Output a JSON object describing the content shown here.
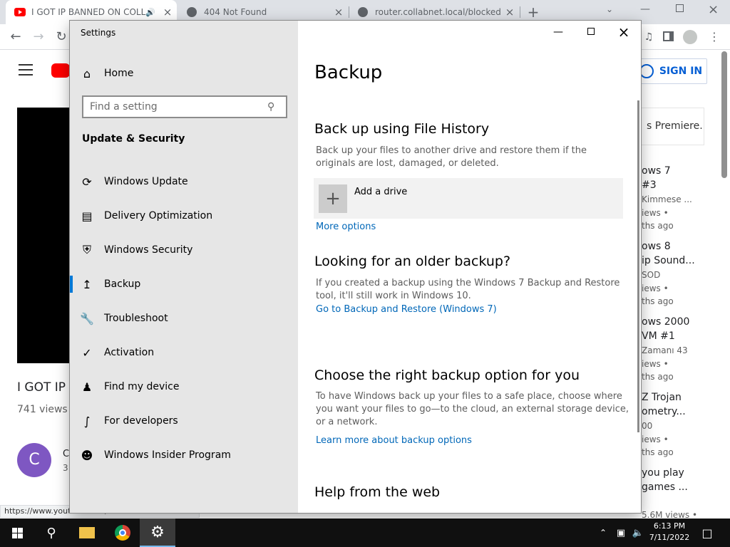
{
  "browser": {
    "tabs": [
      {
        "title": "I GOT IP BANNED ON COLLA",
        "icon": "youtube-icon"
      },
      {
        "title": "404 Not Found",
        "icon": "globe-icon"
      },
      {
        "title": "router.collabnet.local/blocked.ph",
        "icon": "globe-icon"
      }
    ],
    "status_url": "https://www.youtube.com/watch?v=..."
  },
  "youtube": {
    "sign_in": "SIGN IN",
    "premiere_text": "s Premiere.",
    "video_title": "I GOT IP B",
    "views": "741 views •",
    "avatar_letter": "C",
    "channel_initial": "C",
    "sub_count": "3",
    "recs": [
      {
        "l1": "ows 7",
        "l2": "#3",
        "l3": "Kimmese ...",
        "l4": "iews •",
        "l5": "ths ago"
      },
      {
        "l1": "ows 8",
        "l2": "ip Sound...",
        "l3": "SOD",
        "l4": "iews •",
        "l5": "ths ago"
      },
      {
        "l1": "ows 2000",
        "l2": "VM #1",
        "l3": "Zamanı 43",
        "l4": "iews •",
        "l5": "ths ago"
      },
      {
        "l1": "Z Trojan",
        "l2": "ometry...",
        "l3": "00",
        "l4": "iews •",
        "l5": "ths ago"
      },
      {
        "l1": "you play",
        "l2": "games ...",
        "l3": "",
        "l4": "5.6M views •",
        "l5": ""
      }
    ]
  },
  "settings": {
    "window_title": "Settings",
    "home": "Home",
    "search_placeholder": "Find a setting",
    "section": "Update & Security",
    "nav": [
      {
        "label": "Windows Update",
        "icon": "sync-icon"
      },
      {
        "label": "Delivery Optimization",
        "icon": "delivery-icon"
      },
      {
        "label": "Windows Security",
        "icon": "shield-icon"
      },
      {
        "label": "Backup",
        "icon": "backup-arrow-icon",
        "selected": true
      },
      {
        "label": "Troubleshoot",
        "icon": "wrench-icon"
      },
      {
        "label": "Activation",
        "icon": "check-circle-icon"
      },
      {
        "label": "Find my device",
        "icon": "person-pin-icon"
      },
      {
        "label": "For developers",
        "icon": "developer-icon"
      },
      {
        "label": "Windows Insider Program",
        "icon": "insider-cat-icon"
      }
    ],
    "page_title": "Backup",
    "file_history": {
      "heading": "Back up using File History",
      "desc": "Back up your files to another drive and restore them if the originals are lost, damaged, or deleted.",
      "add_drive": "Add a drive",
      "more_options": "More options"
    },
    "older": {
      "heading": "Looking for an older backup?",
      "desc": "If you created a backup using the Windows 7 Backup and Restore tool, it'll still work in Windows 10.",
      "link": "Go to Backup and Restore (Windows 7)"
    },
    "choose": {
      "heading": "Choose the right backup option for you",
      "desc": "To have Windows back up your files to a safe place, choose where you want your files to go—to the cloud, an external storage device, or a network.",
      "link": "Learn more about backup options"
    },
    "help_heading": "Help from the web"
  },
  "taskbar": {
    "time": "6:13 PM",
    "date": "7/11/2022"
  },
  "colors": {
    "accent": "#0078d7",
    "link": "#0067b8",
    "youtube_red": "#ff0000"
  }
}
